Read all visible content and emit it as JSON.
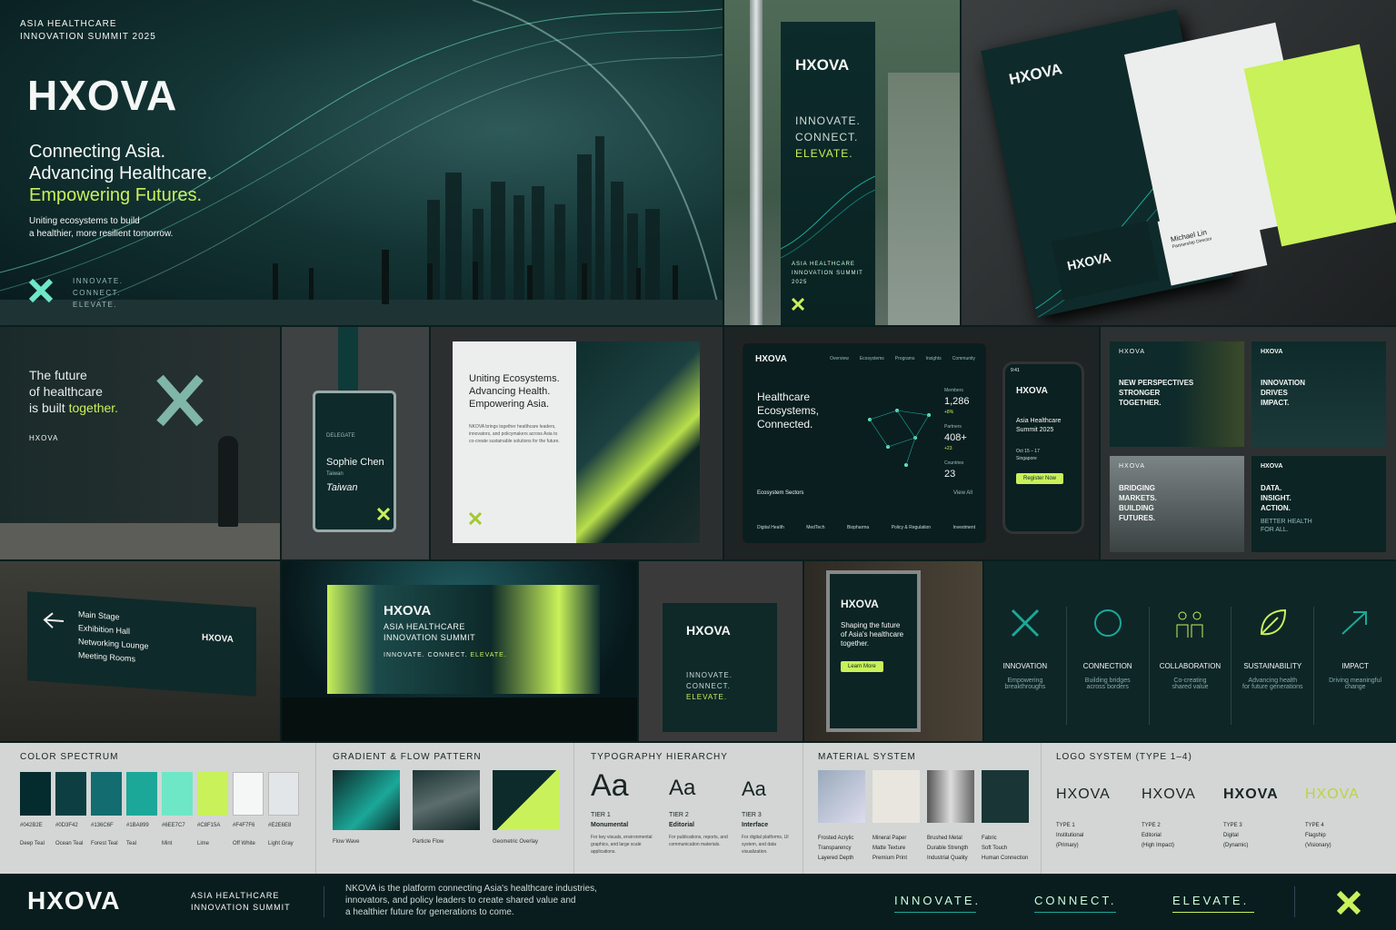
{
  "hero": {
    "event": "ASIA HEALTHCARE\nINNOVATION SUMMIT 2025",
    "logo": "HXOVA",
    "line1": "Connecting Asia.",
    "line2": "Advancing Healthcare.",
    "line3": "Empowering Futures.",
    "sub1": "Uniting ecosystems to build",
    "sub2": "a healthier, more resilient tomorrow.",
    "tag1": "INNOVATE.",
    "tag2": "CONNECT.",
    "tag3": "ELEVATE."
  },
  "banner": {
    "logo": "HXOVA",
    "t1": "INNOVATE.",
    "t2": "CONNECT.",
    "t3": "ELEVATE.",
    "event": "ASIA HEALTHCARE\nINNOVATION SUMMIT\n2025"
  },
  "stationery": {
    "logo": "HXOVA",
    "card_logo": "HXOVA",
    "name": "Michael Lin",
    "role": "Partnership Director"
  },
  "wall": {
    "l1": "The future",
    "l2": "of healthcare",
    "l3": "is built ",
    "l3b": "together.",
    "brand": "HXOVA"
  },
  "badge": {
    "role": "DELEGATE",
    "name": "Sophie Chen",
    "country": "Taiwan",
    "sig": "Taiwan"
  },
  "book": {
    "h1": "Uniting Ecosystems.",
    "h2": "Advancing Health.",
    "h3": "Empowering Asia.",
    "body": "NKOVA brings together healthcare leaders, innovators, and policymakers across Asia to co-create sustainable solutions for the future."
  },
  "tablet": {
    "logo": "HXOVA",
    "nav": [
      "Overview",
      "Ecosystems",
      "Programs",
      "Insights",
      "Community"
    ],
    "h1": "Healthcare",
    "h2": "Ecosystems,",
    "h3": "Connected.",
    "stats": [
      {
        "l": "Members",
        "v": "1,286",
        "d": "+8%"
      },
      {
        "l": "Partners",
        "v": "408+",
        "d": "+23"
      },
      {
        "l": "Countries",
        "v": "23",
        "d": ""
      }
    ],
    "sectors_title": "Ecosystem Sectors",
    "view_all": "View All",
    "sectors": [
      "Digital Health",
      "MedTech",
      "Biopharma",
      "Policy & Regulation",
      "Investment"
    ]
  },
  "phone": {
    "time": "9:41",
    "logo": "HXOVA",
    "e1": "Asia Healthcare",
    "e2": "Summit 2025",
    "d1": "Oct 15 – 17",
    "d2": "Singapore",
    "cta": "Register Now"
  },
  "social": [
    {
      "brand": "HXOVA",
      "t": "NEW PERSPECTIVES\nSTRONGER\nTOGETHER."
    },
    {
      "brand": "HXOVA",
      "t": "INNOVATION\nDRIVES\nIMPACT."
    },
    {
      "brand": "HXOVA",
      "t": "BRIDGING\nMARKETS.\nBUILDING\nFUTURES."
    },
    {
      "brand": "HXOVA",
      "t": "DATA.\nINSIGHT.\nACTION.",
      "s": "BETTER HEALTH\nFOR ALL."
    }
  ],
  "sign": {
    "items": [
      "Main Stage",
      "Exhibition Hall",
      "Networking Lounge",
      "Meeting Rooms"
    ],
    "logo": "HXOVA"
  },
  "stage": {
    "logo": "HXOVA",
    "l1": "ASIA HEALTHCARE",
    "l2": "INNOVATION SUMMIT",
    "tag": "INNOVATE. CONNECT. ",
    "tag2": "ELEVATE."
  },
  "tote": {
    "logo": "HXOVA",
    "t1": "INNOVATE.",
    "t2": "CONNECT.",
    "t3": "ELEVATE."
  },
  "kiosk": {
    "logo": "HXOVA",
    "h": "Shaping the future\nof Asia's healthcare\ntogether.",
    "cta": "Learn More"
  },
  "values": [
    {
      "name": "INNOVATION",
      "d": "Empowering\nbreakthroughs",
      "icon": "x-mark-icon"
    },
    {
      "name": "CONNECTION",
      "d": "Building bridges\nacross borders",
      "icon": "network-circle-icon"
    },
    {
      "name": "COLLABORATION",
      "d": "Co-creating\nshared value",
      "icon": "people-icon"
    },
    {
      "name": "SUSTAINABILITY",
      "d": "Advancing health\nfor future generations",
      "icon": "leaf-icon"
    },
    {
      "name": "IMPACT",
      "d": "Driving meaningful\nchange",
      "icon": "arrow-up-icon"
    }
  ],
  "colors": {
    "title": "COLOR SPECTRUM",
    "swatches": [
      {
        "hex": "#042B2E",
        "name": "Deep Teal"
      },
      {
        "hex": "#0D3F42",
        "name": "Ocean Teal"
      },
      {
        "hex": "#136C6F",
        "name": "Forest Teal"
      },
      {
        "hex": "#1BA899",
        "name": "Teal"
      },
      {
        "hex": "#6EE7C7",
        "name": "Mint"
      },
      {
        "hex": "#C8F15A",
        "name": "Lime"
      },
      {
        "hex": "#F4F7F6",
        "name": "Off White"
      },
      {
        "hex": "#E2E6E8",
        "name": "Light Gray"
      }
    ]
  },
  "gradients": {
    "title": "GRADIENT & FLOW PATTERN",
    "items": [
      "Flow Wave",
      "Particle Flow",
      "Geometric Overlay"
    ]
  },
  "typography": {
    "title": "TYPOGRAPHY HIERARCHY",
    "glyph": "Aa",
    "tiers": [
      {
        "t": "TIER 1",
        "n": "Monumental",
        "d": "For key visuals, environmental graphics, and large scale applications."
      },
      {
        "t": "TIER 2",
        "n": "Editorial",
        "d": "For publications, reports, and communication materials."
      },
      {
        "t": "TIER 3",
        "n": "Interface",
        "d": "For digital platforms, UI system, and data visualization."
      }
    ]
  },
  "materials": {
    "title": "MATERIAL SYSTEM",
    "items": [
      {
        "n": "Frosted Acrylic",
        "a": "Transparency",
        "b": "Layered Depth"
      },
      {
        "n": "Mineral Paper",
        "a": "Matte Texture",
        "b": "Premium Print"
      },
      {
        "n": "Brushed Metal",
        "a": "Durable Strength",
        "b": "Industrial Quality"
      },
      {
        "n": "Fabric",
        "a": "Soft Touch",
        "b": "Human Connection"
      }
    ]
  },
  "logos": {
    "title": "LOGO SYSTEM (TYPE 1–4)",
    "word": "HXOVA",
    "items": [
      {
        "t": "TYPE 1",
        "a": "Institutional",
        "b": "(Primary)"
      },
      {
        "t": "TYPE 2",
        "a": "Editorial",
        "b": "(High Impact)"
      },
      {
        "t": "TYPE 3",
        "a": "Digital",
        "b": "(Dynamic)"
      },
      {
        "t": "TYPE 4",
        "a": "Flagship",
        "b": "(Visionary)"
      }
    ]
  },
  "footer": {
    "logo": "HXOVA",
    "event": "ASIA HEALTHCARE\nINNOVATION SUMMIT",
    "desc": "NKOVA is the platform connecting Asia's healthcare industries,\ninnovators, and policy leaders to create shared value and\na healthier future for generations to come.",
    "t1": "INNOVATE.",
    "t2": "CONNECT.",
    "t3": "ELEVATE."
  }
}
